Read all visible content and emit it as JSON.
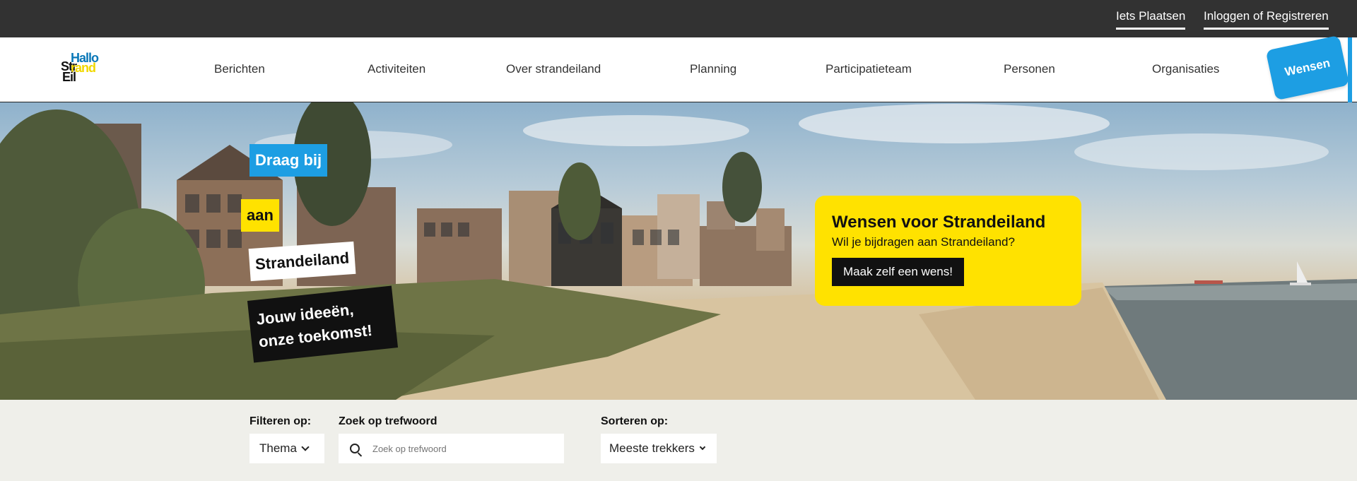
{
  "topbar": {
    "links": [
      "Iets Plaatsen",
      "Inloggen of Registreren"
    ]
  },
  "logo": {
    "line1": "Hallo",
    "line2a": "Str",
    "line2b": "rand",
    "line3": "Eil"
  },
  "nav": {
    "items": [
      "Berichten",
      "Activiteiten",
      "Over strandeiland",
      "Planning",
      "Participatieteam",
      "Personen",
      "Organisaties"
    ],
    "cta_label": "Wensen"
  },
  "hero": {
    "tag1": "Draag bij",
    "tag2": "aan",
    "tag3": "Strandeiland",
    "tag4": "Jouw ideeën, onze toekomst!"
  },
  "wish_card": {
    "title": "Wensen voor Strandeiland",
    "subtitle": "Wil je bijdragen aan Strandeiland?",
    "button_label": "Maak zelf een wens!"
  },
  "filters": {
    "filter_label": "Filteren op:",
    "theme_value": "Thema",
    "search_label": "Zoek op trefwoord",
    "search_placeholder": "Zoek op trefwoord",
    "sort_label": "Sorteren op:",
    "sort_value": "Meeste trekkers"
  },
  "colors": {
    "topbar_bg": "#323232",
    "accent_blue": "#1d9ee3",
    "accent_yellow": "#ffe200",
    "filter_bg": "#efefea"
  }
}
